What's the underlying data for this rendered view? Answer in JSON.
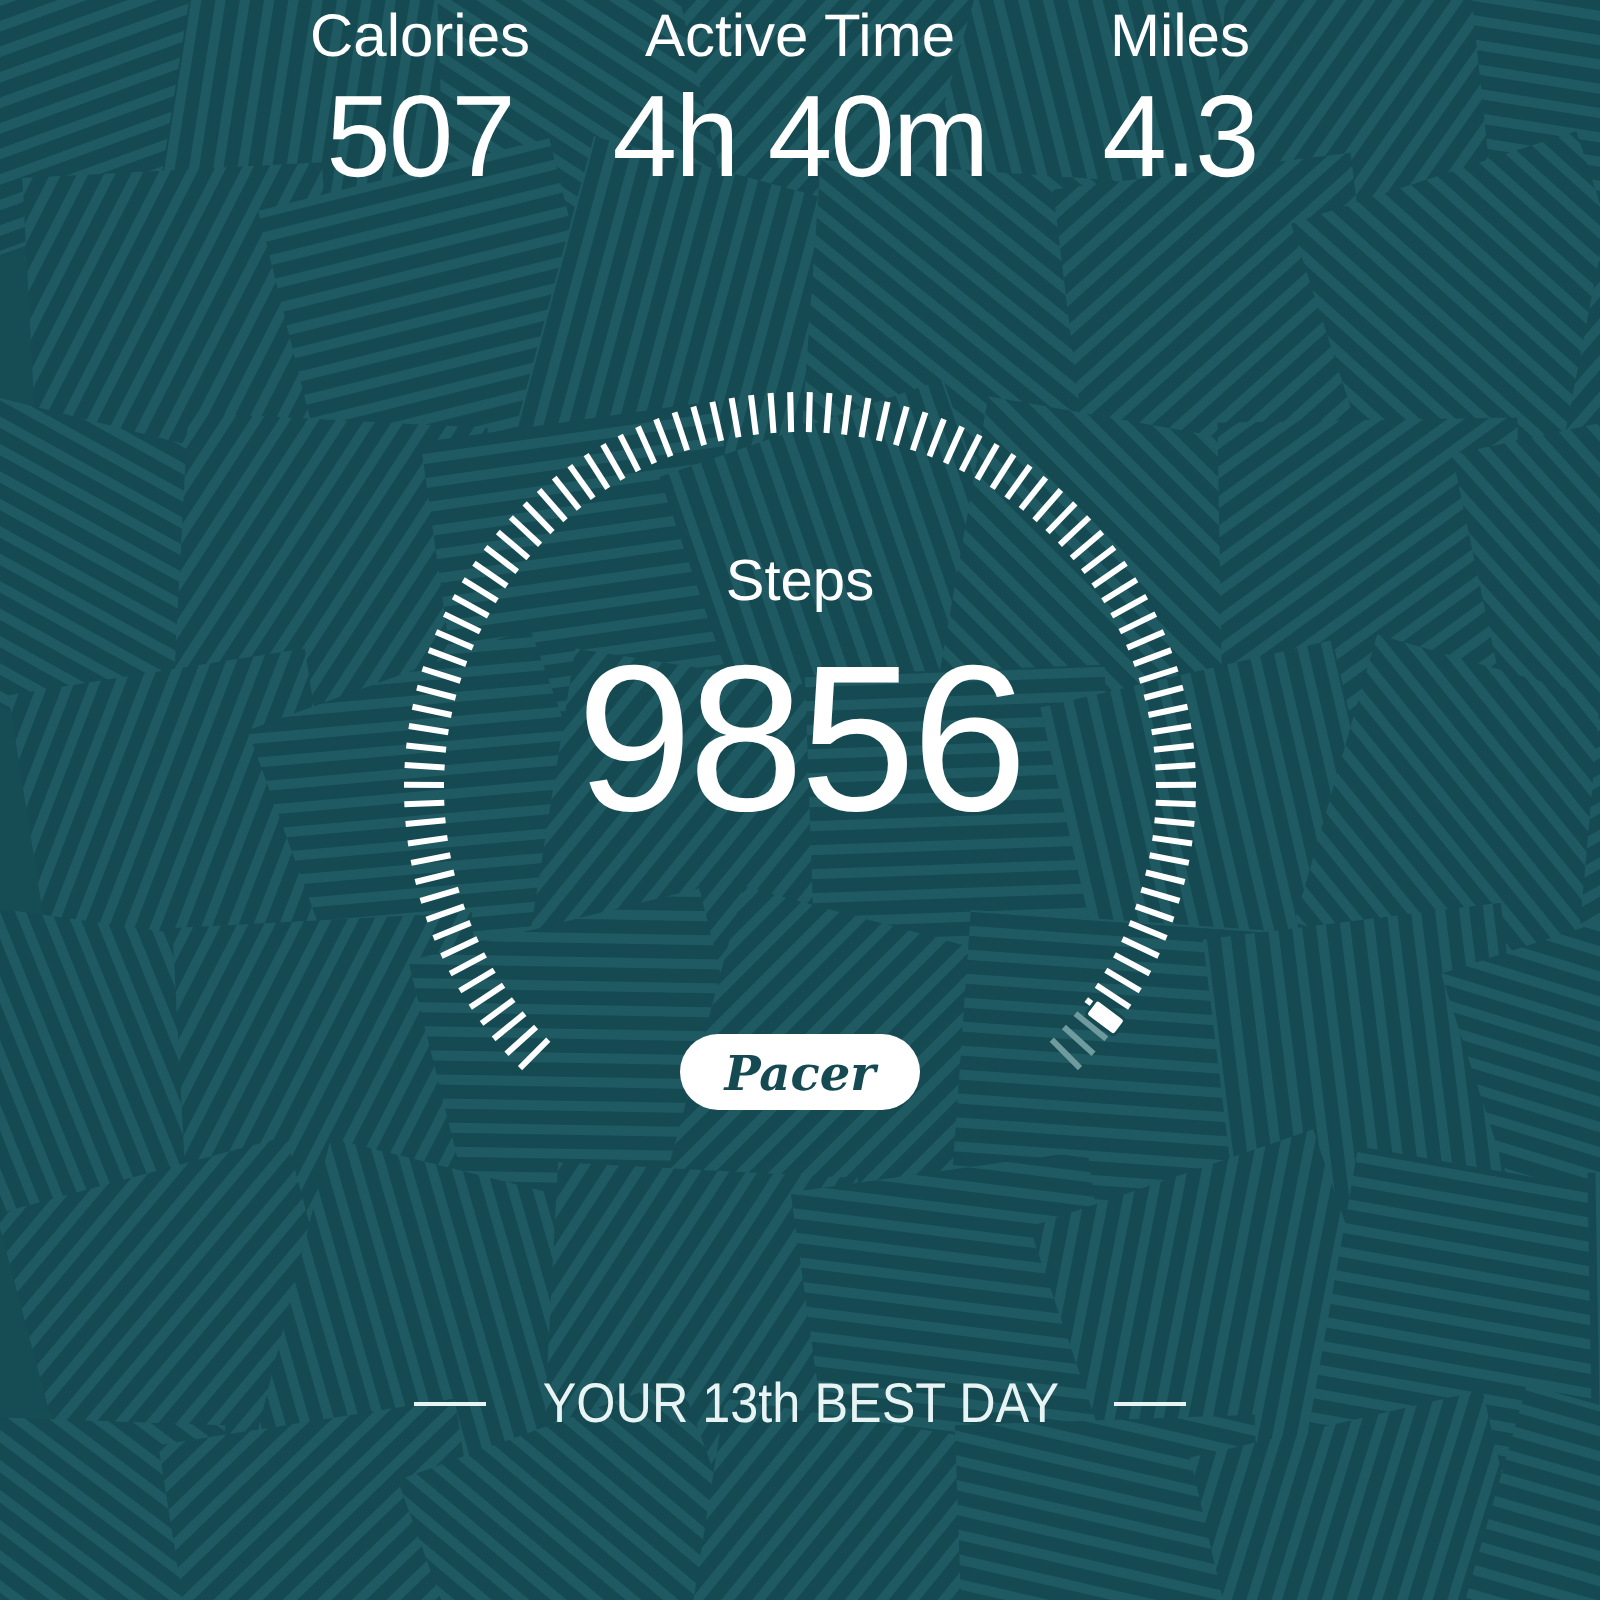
{
  "stats": [
    {
      "label": "Calories",
      "value": "507"
    },
    {
      "label": "Active Time",
      "value": "4h 40m"
    },
    {
      "label": "Miles",
      "value": "4.3"
    }
  ],
  "gauge": {
    "label": "Steps",
    "value": "9856",
    "brand": "Pacer"
  },
  "rank": {
    "text": "YOUR 13th BEST DAY"
  }
}
